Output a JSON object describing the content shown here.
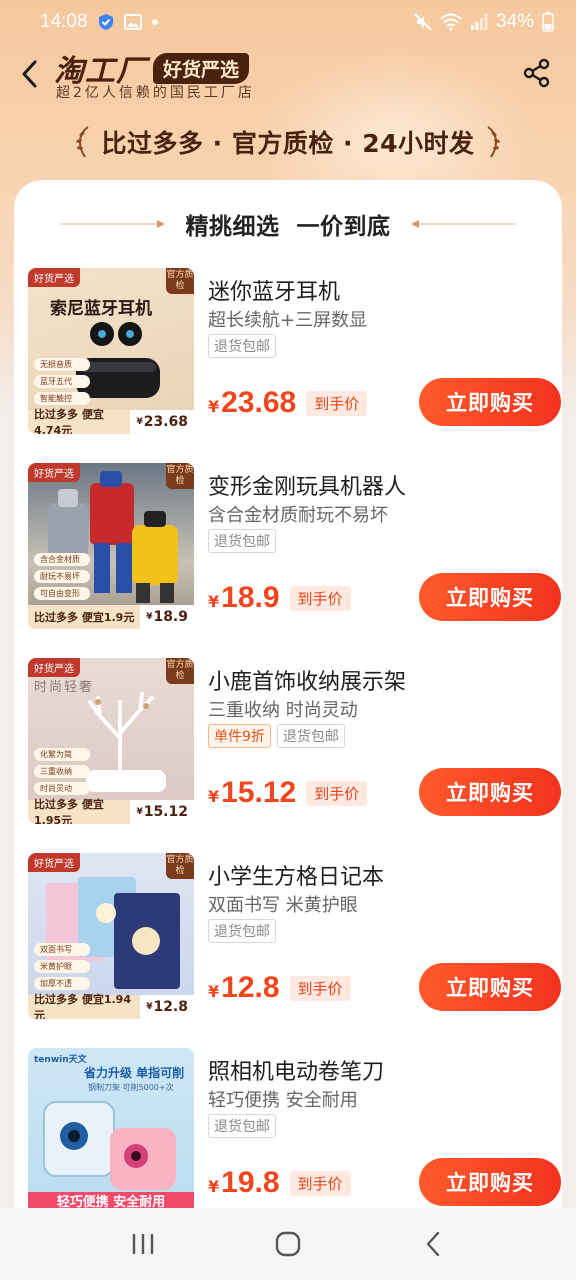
{
  "status_bar": {
    "time": "14:08",
    "battery": "34%"
  },
  "header": {
    "brand_name": "淘工厂",
    "brand_badge": "好货严选",
    "brand_subtitle": "超2亿人信赖的国民工厂店"
  },
  "slogan": "比过多多 · 官方质检 · 24小时发",
  "section_title": "精挑细选  一价到底",
  "products": [
    {
      "title": "迷你蓝牙耳机",
      "subtitle": "超长续航+三屏数显",
      "tags": [
        "退货包邮"
      ],
      "price_symbol": "¥",
      "price": "23.68",
      "price_label": "到手价",
      "buy_label": "立即购买",
      "thumb_tag_left": "好货严选",
      "thumb_tag_right": "官方质检",
      "thumb_heading": "索尼蓝牙耳机",
      "thumb_bottom_text": "比过多多 便宜4.74元",
      "thumb_bottom_price": "23.68",
      "thumb_features": [
        "无损音质",
        "蓝牙五代",
        "智能触控"
      ]
    },
    {
      "title": "变形金刚玩具机器人",
      "subtitle": "含合金材质耐玩不易坏",
      "tags": [
        "退货包邮"
      ],
      "price_symbol": "¥",
      "price": "18.9",
      "price_label": "到手价",
      "buy_label": "立即购买",
      "thumb_tag_left": "好货严选",
      "thumb_tag_right": "官方质检",
      "thumb_bottom_text": "比过多多 便宜1.9元",
      "thumb_bottom_price": "18.9",
      "thumb_features": [
        "含合金材质",
        "耐玩不易坏",
        "可自由变形"
      ]
    },
    {
      "title": "小鹿首饰收纳展示架",
      "subtitle": "三重收纳 时尚灵动",
      "tags": [
        "单件9折",
        "退货包邮"
      ],
      "price_symbol": "¥",
      "price": "15.12",
      "price_label": "到手价",
      "buy_label": "立即购买",
      "thumb_tag_left": "好货严选",
      "thumb_tag_right": "官方质检",
      "thumb_heading": "时尚轻奢",
      "thumb_bottom_text": "比过多多 便宜1.95元",
      "thumb_bottom_price": "15.12",
      "thumb_features": [
        "化繁为简",
        "三重收纳",
        "时尚灵动"
      ]
    },
    {
      "title": "小学生方格日记本",
      "subtitle": "双面书写 米黄护眼",
      "tags": [
        "退货包邮"
      ],
      "price_symbol": "¥",
      "price": "12.8",
      "price_label": "到手价",
      "buy_label": "立即购买",
      "thumb_tag_left": "好货严选",
      "thumb_tag_right": "官方质检",
      "thumb_bottom_text": "比过多多 便宜1.94元",
      "thumb_bottom_price": "12.8",
      "thumb_features": [
        "双面书写",
        "米黄护眼",
        "加厚不透"
      ]
    },
    {
      "title": "照相机电动卷笔刀",
      "subtitle": "轻巧便携 安全耐用",
      "tags": [
        "退货包邮"
      ],
      "price_symbol": "¥",
      "price": "19.8",
      "price_label": "到手价",
      "buy_label": "立即购买",
      "thumb_brand": "tenwin天文",
      "thumb_heading": "省力升级 单指可削",
      "thumb_subheading": "钢制刀架 可削5000+次",
      "thumb_bottom_text": "轻巧便携 安全耐用"
    }
  ],
  "colors": {
    "accent": "#f0451d",
    "brand_dark": "#4a2210",
    "header_bg": "#f6c89e"
  }
}
